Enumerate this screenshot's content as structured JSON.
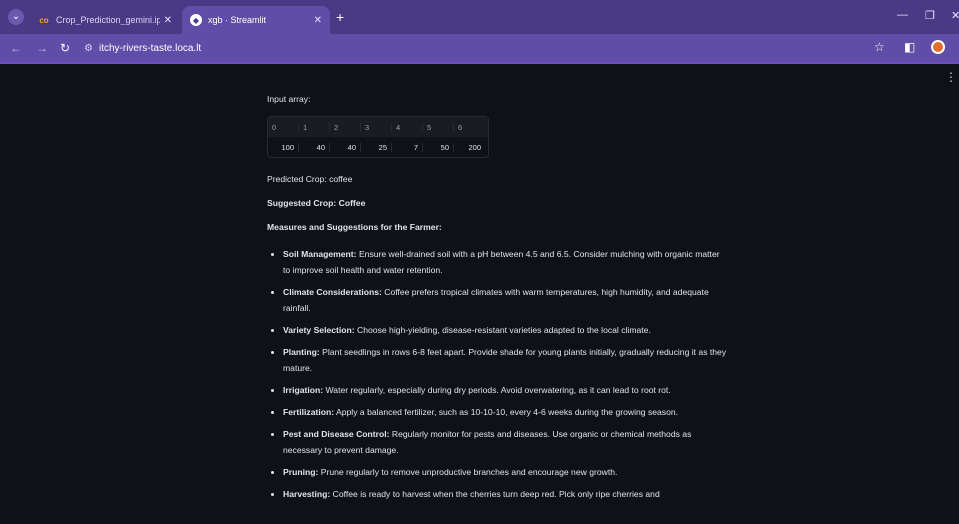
{
  "browser": {
    "tabs": [
      {
        "title": "Crop_Prediction_gemini.ipynb - ",
        "active": false
      },
      {
        "title": "xgb · Streamlit",
        "active": true
      }
    ],
    "url": "itchy-rivers-taste.loca.lt"
  },
  "main": {
    "input_label": "Input array:",
    "dataframe": {
      "columns": [
        "0",
        "1",
        "2",
        "3",
        "4",
        "5",
        "6"
      ],
      "row": [
        "100",
        "40",
        "40",
        "25",
        "7",
        "50",
        "200"
      ]
    },
    "predicted": "Predicted Crop: coffee",
    "suggested": "Suggested Crop: Coffee",
    "measures_heading": "Measures and Suggestions for the Farmer:",
    "suggestions": [
      {
        "label": "Soil Management:",
        "text": "Ensure well-drained soil with a pH between 4.5 and 6.5. Consider mulching with organic matter to improve soil health and water retention."
      },
      {
        "label": "Climate Considerations:",
        "text": "Coffee prefers tropical climates with warm temperatures, high humidity, and adequate rainfall."
      },
      {
        "label": "Variety Selection:",
        "text": "Choose high-yielding, disease-resistant varieties adapted to the local climate."
      },
      {
        "label": "Planting:",
        "text": "Plant seedlings in rows 6-8 feet apart. Provide shade for young plants initially, gradually reducing it as they mature."
      },
      {
        "label": "Irrigation:",
        "text": "Water regularly, especially during dry periods. Avoid overwatering, as it can lead to root rot."
      },
      {
        "label": "Fertilization:",
        "text": "Apply a balanced fertilizer, such as 10-10-10, every 4-6 weeks during the growing season."
      },
      {
        "label": "Pest and Disease Control:",
        "text": "Regularly monitor for pests and diseases. Use organic or chemical methods as necessary to prevent damage."
      },
      {
        "label": "Pruning:",
        "text": "Prune regularly to remove unproductive branches and encourage new growth."
      },
      {
        "label": "Harvesting:",
        "text": "Coffee is ready to harvest when the cherries turn deep red. Pick only ripe cherries and"
      }
    ]
  },
  "colors": {
    "tabbar": "#4a3a86",
    "toolbar": "#5f4da8",
    "page_bg": "#0e1117"
  }
}
